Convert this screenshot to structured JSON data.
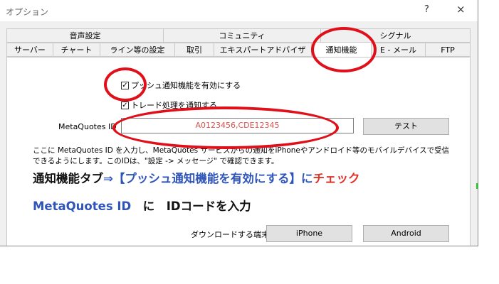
{
  "window": {
    "title": "オプション",
    "help": "?",
    "close": "×"
  },
  "tabs": {
    "back_row": [
      "音声設定",
      "コミュニティ",
      "シグナル"
    ],
    "front_row": [
      "サーバー",
      "チャート",
      "ライン等の設定",
      "取引",
      "エキスパートアドバイザ",
      "通知機能",
      "E - メール",
      "FTP"
    ],
    "active": "通知機能"
  },
  "notifications": {
    "push_label": "プッシュ通知機能を有効にする",
    "push_checked": true,
    "trade_label": "トレード処理を通知する",
    "trade_checked": true,
    "id_label": "MetaQuotes ID",
    "id_value": "A0123456,CDE12345",
    "test_button": "テスト",
    "description": "ここに MetaQuotes ID を入力し、MetaQuotes サービスからの通知をiPhoneやアンドロイド等のモバイルデバイスで受信できるようにします。このIDは、\"設定 -> メッセージ\" で確認できます。",
    "download_label": "ダウンロードする端末:",
    "iphone_button": "iPhone",
    "android_button": "Android"
  },
  "overlay": {
    "line1_a": "通知機能タブ",
    "line1_b": "⇒【プッシュ通知機能を有効にする】に",
    "line1_c": "チェック",
    "line2_a": "MetaQuotes ID",
    "line2_b": "に　IDコードを入力"
  },
  "colors": {
    "annotation": "#e0101a",
    "overlay_blue": "#2f55b8",
    "overlay_red": "#e0302a"
  }
}
